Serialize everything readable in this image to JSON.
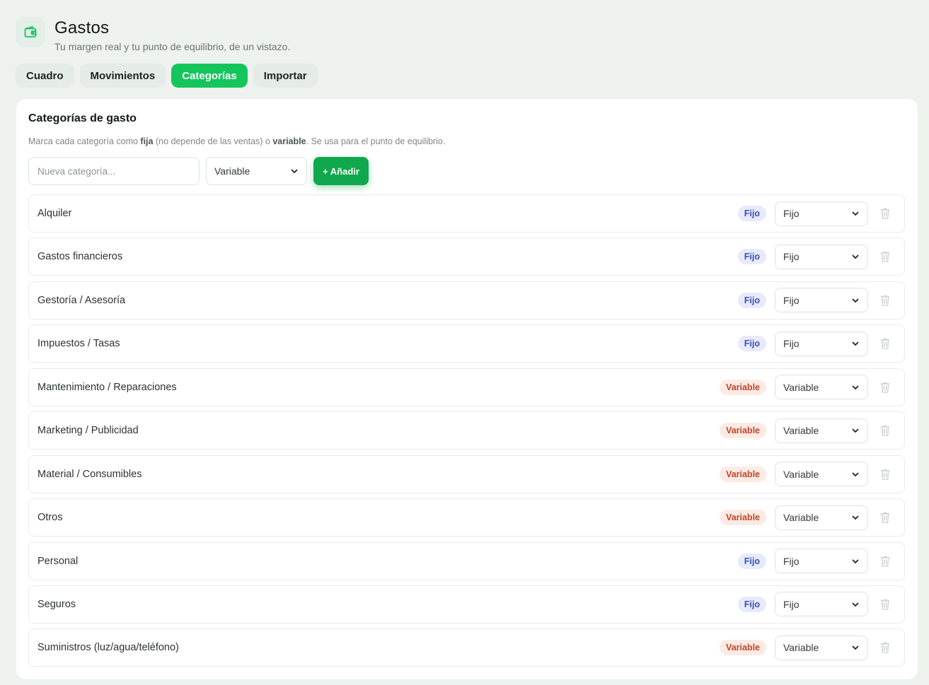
{
  "header": {
    "title": "Gastos",
    "subtitle": "Tu margen real y tu punto de equilibrio, de un vistazo."
  },
  "tabs": [
    {
      "label": "Cuadro",
      "active": false
    },
    {
      "label": "Movimientos",
      "active": false
    },
    {
      "label": "Categorías",
      "active": true
    },
    {
      "label": "Importar",
      "active": false
    }
  ],
  "card": {
    "title": "Categorías de gasto",
    "desc_part1": "Marca cada categoría como ",
    "desc_fija": "fija",
    "desc_part2": " (no depende de las ventas) o ",
    "desc_variable": "variable",
    "desc_part3": ". Se usa para el punto de equilibrio."
  },
  "new_category": {
    "placeholder": "Nueva categoría...",
    "type_value": "Variable",
    "add_label": "+ Añadir"
  },
  "categories": [
    {
      "name": "Alquiler",
      "badge": "Fijo",
      "type": "fijo",
      "select": "Fijo"
    },
    {
      "name": "Gastos financieros",
      "badge": "Fijo",
      "type": "fijo",
      "select": "Fijo"
    },
    {
      "name": "Gestoría / Asesoría",
      "badge": "Fijo",
      "type": "fijo",
      "select": "Fijo"
    },
    {
      "name": "Impuestos / Tasas",
      "badge": "Fijo",
      "type": "fijo",
      "select": "Fijo"
    },
    {
      "name": "Mantenimiento / Reparaciones",
      "badge": "Variable",
      "type": "variable",
      "select": "Variable"
    },
    {
      "name": "Marketing / Publicidad",
      "badge": "Variable",
      "type": "variable",
      "select": "Variable"
    },
    {
      "name": "Material / Consumibles",
      "badge": "Variable",
      "type": "variable",
      "select": "Variable"
    },
    {
      "name": "Otros",
      "badge": "Variable",
      "type": "variable",
      "select": "Variable"
    },
    {
      "name": "Personal",
      "badge": "Fijo",
      "type": "fijo",
      "select": "Fijo"
    },
    {
      "name": "Seguros",
      "badge": "Fijo",
      "type": "fijo",
      "select": "Fijo"
    },
    {
      "name": "Suministros (luz/agua/teléfono)",
      "badge": "Variable",
      "type": "variable",
      "select": "Variable"
    }
  ],
  "icons": {
    "header": "wallet-icon",
    "row_action": "trash-icon",
    "select": "chevron-down-icon"
  },
  "colors": {
    "accent": "#14c55c",
    "accent_dark": "#10a84c",
    "fijo_bg": "#e6eafb",
    "fijo_text": "#3a4fb8",
    "variable_bg": "#fcebe4",
    "variable_text": "#c0452b"
  }
}
